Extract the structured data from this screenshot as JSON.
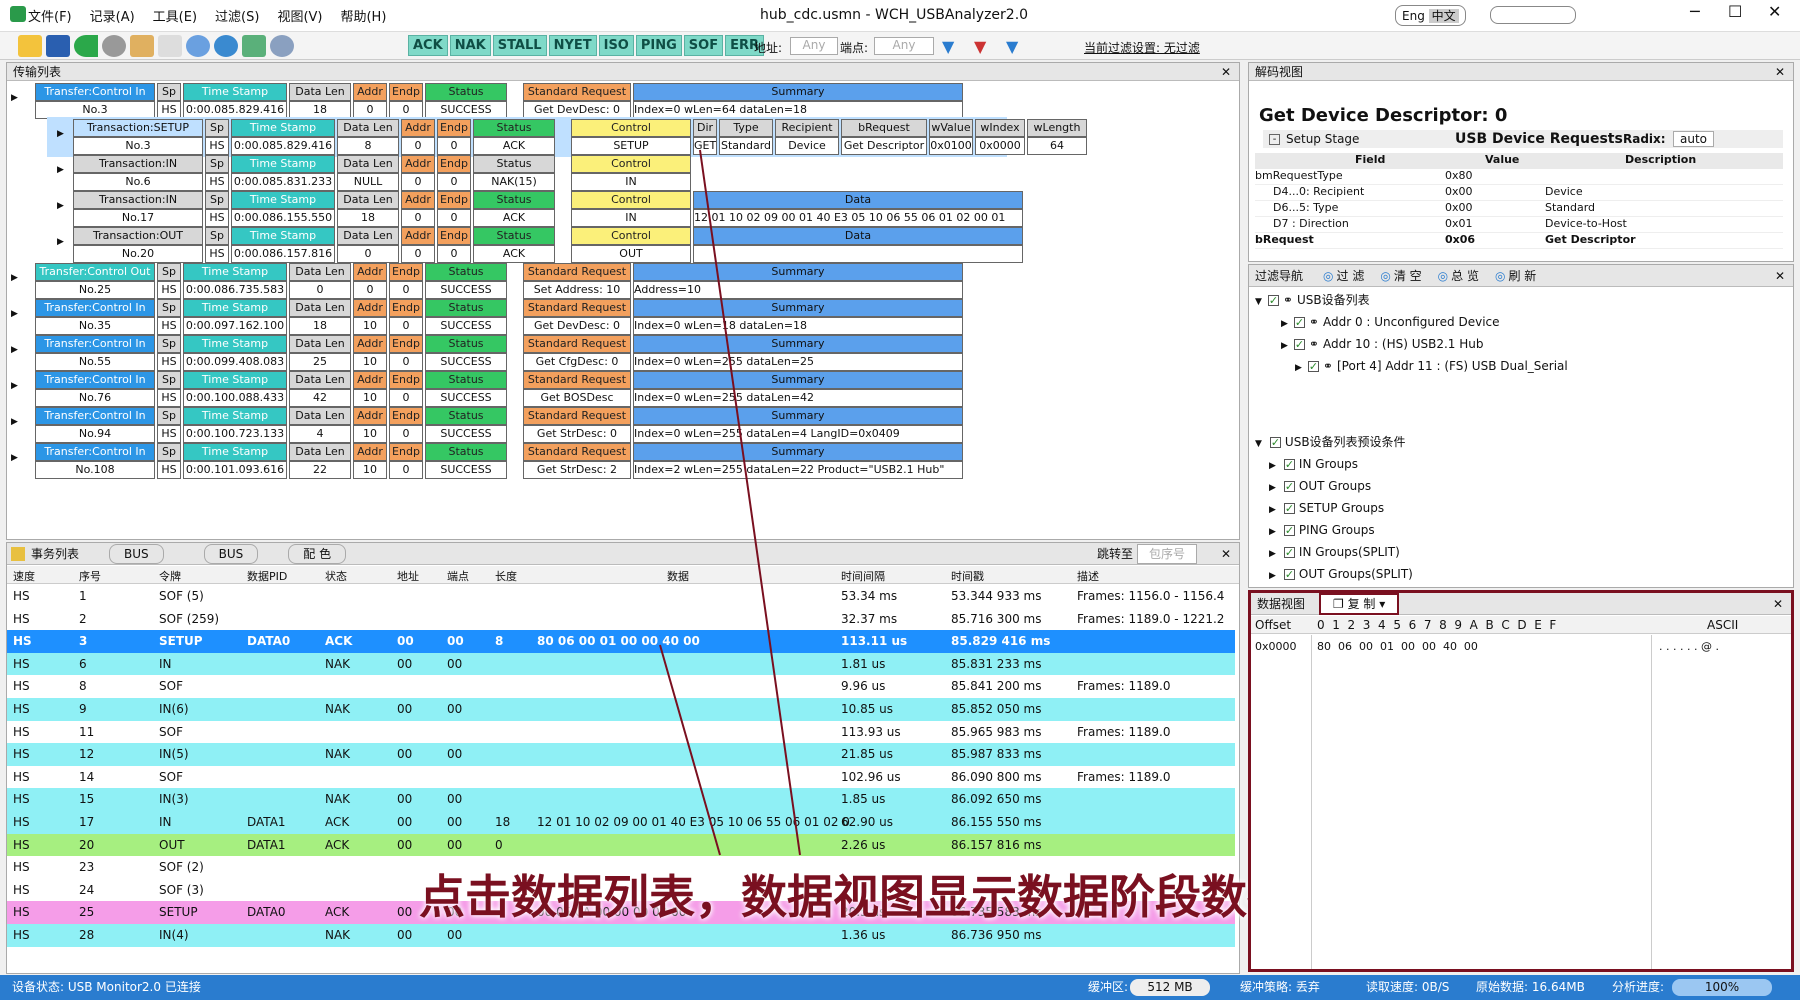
{
  "app": {
    "window_title": "hub_cdc.usmn - WCH_USBAnalyzer2.0",
    "lang": [
      "Eng",
      "中文"
    ],
    "menu": [
      "文件(F)",
      "记录(A)",
      "工具(E)",
      "过滤(S)",
      "视图(V)",
      "帮助(H)"
    ]
  },
  "toolbar": {
    "filters": [
      "ACK",
      "NAK",
      "STALL",
      "NYET",
      "ISO",
      "PING",
      "SOF",
      "ERR"
    ],
    "addr_label": "地址:",
    "addr_value": "Any",
    "endp_label": "端点:",
    "endp_value": "Any",
    "filter_setting": "当前过滤设置: 无过滤"
  },
  "transfer_pane": {
    "title": "传输列表",
    "header": {
      "tr": "Transfer:Control In",
      "sp": "Sp",
      "ts": "Time Stamp",
      "dl": "Data Len",
      "addr": "Addr",
      "endp": "Endp",
      "status": "Status",
      "std": "Standard Request",
      "sum": "Summary"
    },
    "rows": [
      {
        "type": "Transfer:Control In",
        "no": "No.3",
        "sp": "HS",
        "ts": "0:00.085.829.416",
        "dl": "18",
        "addr": "0",
        "endp": "0",
        "status": "SUCCESS",
        "req": "Get DevDesc: 0",
        "summary": "Index=0  wLen=64  dataLen=18"
      },
      {
        "type": "Transfer:Control Out",
        "no": "No.25",
        "sp": "HS",
        "ts": "0:00.086.735.583",
        "dl": "0",
        "addr": "0",
        "endp": "0",
        "status": "SUCCESS",
        "req": "Set Address: 10",
        "summary": "Address=10"
      },
      {
        "type": "Transfer:Control In",
        "no": "No.35",
        "sp": "HS",
        "ts": "0:00.097.162.100",
        "dl": "18",
        "addr": "10",
        "endp": "0",
        "status": "SUCCESS",
        "req": "Get DevDesc: 0",
        "summary": "Index=0  wLen=18  dataLen=18"
      },
      {
        "type": "Transfer:Control In",
        "no": "No.55",
        "sp": "HS",
        "ts": "0:00.099.408.083",
        "dl": "25",
        "addr": "10",
        "endp": "0",
        "status": "SUCCESS",
        "req": "Get CfgDesc: 0",
        "summary": "Index=0  wLen=255  dataLen=25"
      },
      {
        "type": "Transfer:Control In",
        "no": "No.76",
        "sp": "HS",
        "ts": "0:00.100.088.433",
        "dl": "42",
        "addr": "10",
        "endp": "0",
        "status": "SUCCESS",
        "req": "Get BOSDesc",
        "summary": "Index=0  wLen=255  dataLen=42"
      },
      {
        "type": "Transfer:Control In",
        "no": "No.94",
        "sp": "HS",
        "ts": "0:00.100.723.133",
        "dl": "4",
        "addr": "10",
        "endp": "0",
        "status": "SUCCESS",
        "req": "Get StrDesc: 0",
        "summary": "Index=0  wLen=255  dataLen=4  LangID=0x0409"
      },
      {
        "type": "Transfer:Control In",
        "no": "No.108",
        "sp": "HS",
        "ts": "0:00.101.093.616",
        "dl": "22",
        "addr": "10",
        "endp": "0",
        "status": "SUCCESS",
        "req": "Get StrDesc: 2",
        "summary": "Index=2  wLen=255  dataLen=22  Product=\"USB2.1 Hub\""
      }
    ],
    "transactions": [
      {
        "type": "Transaction:SETUP",
        "no": "No.3",
        "sp": "HS",
        "ts": "0:00.085.829.416",
        "dl": "8",
        "addr": "0",
        "endp": "0",
        "status": "ACK",
        "ctrl": "SETUP",
        "dir": "GET",
        "typ": "Standard",
        "rec": "Device",
        "breq": "Get Descriptor",
        "wval": "0x0100",
        "widx": "0x0000",
        "wlen": "64"
      },
      {
        "type": "Transaction:IN",
        "no": "No.6",
        "sp": "HS",
        "ts": "0:00.085.831.233",
        "dl": "NULL",
        "addr": "0",
        "endp": "0",
        "status": "NAK(15)",
        "ctrl": "IN"
      },
      {
        "type": "Transaction:IN",
        "no": "No.17",
        "sp": "HS",
        "ts": "0:00.086.155.550",
        "dl": "18",
        "addr": "0",
        "endp": "0",
        "status": "ACK",
        "ctrl": "IN",
        "data": "12 01 10 02 09 00 01 40 E3 05 10 06 55 06 01 02 00 01"
      },
      {
        "type": "Transaction:OUT",
        "no": "No.20",
        "sp": "HS",
        "ts": "0:00.086.157.816",
        "dl": "0",
        "addr": "0",
        "endp": "0",
        "status": "ACK",
        "ctrl": "OUT",
        "data": ""
      }
    ],
    "setup_hdr": {
      "ctrl": "Control",
      "dir": "Dir",
      "typ": "Type",
      "rec": "Recipient",
      "breq": "bRequest",
      "wval": "wValue",
      "widx": "wIndex",
      "wlen": "wLength",
      "data": "Data"
    }
  },
  "list_pane": {
    "title": "事务列表",
    "tabs": [
      "BUS",
      "BUS",
      "配 色"
    ],
    "jump": "跳转至",
    "jump_ph": "包序号",
    "columns": [
      "速度",
      "序号",
      "令牌",
      "数据PID",
      "状态",
      "地址",
      "端点",
      "长度",
      "数据",
      "时间间隔",
      "时间戳",
      "描述"
    ],
    "rows": [
      {
        "sp": "HS",
        "no": "1",
        "tok": "SOF (5)",
        "pid": "",
        "st": "",
        "ad": "",
        "ep": "",
        "len": "",
        "data": "",
        "ti": "53.34 ms",
        "ts": "53.344 933 ms",
        "desc": "Frames: 1156.0 - 1156.4",
        "c": "#ffffff"
      },
      {
        "sp": "HS",
        "no": "2",
        "tok": "SOF (259)",
        "pid": "",
        "st": "",
        "ad": "",
        "ep": "",
        "len": "",
        "data": "",
        "ti": "32.37 ms",
        "ts": "85.716 300 ms",
        "desc": "Frames: 1189.0 - 1221.2",
        "c": "#ffffff"
      },
      {
        "sp": "HS",
        "no": "3",
        "tok": "SETUP",
        "pid": "DATA0",
        "st": "ACK",
        "ad": "00",
        "ep": "00",
        "len": "8",
        "data": "80 06 00 01 00 00 40 00",
        "ti": "113.11 us",
        "ts": "85.829 416 ms",
        "desc": "",
        "c": "#1e90ff"
      },
      {
        "sp": "HS",
        "no": "6",
        "tok": "IN",
        "pid": "",
        "st": "NAK",
        "ad": "00",
        "ep": "00",
        "len": "",
        "data": "",
        "ti": "1.81 us",
        "ts": "85.831 233 ms",
        "desc": "",
        "c": "#8ff0f5"
      },
      {
        "sp": "HS",
        "no": "8",
        "tok": "SOF",
        "pid": "",
        "st": "",
        "ad": "",
        "ep": "",
        "len": "",
        "data": "",
        "ti": "9.96 us",
        "ts": "85.841 200 ms",
        "desc": "Frames: 1189.0",
        "c": "#ffffff"
      },
      {
        "sp": "HS",
        "no": "9",
        "tok": "IN(6)",
        "pid": "",
        "st": "NAK",
        "ad": "00",
        "ep": "00",
        "len": "",
        "data": "",
        "ti": "10.85 us",
        "ts": "85.852 050 ms",
        "desc": "",
        "c": "#8ff0f5"
      },
      {
        "sp": "HS",
        "no": "11",
        "tok": "SOF",
        "pid": "",
        "st": "",
        "ad": "",
        "ep": "",
        "len": "",
        "data": "",
        "ti": "113.93 us",
        "ts": "85.965 983 ms",
        "desc": "Frames: 1189.0",
        "c": "#ffffff"
      },
      {
        "sp": "HS",
        "no": "12",
        "tok": "IN(5)",
        "pid": "",
        "st": "NAK",
        "ad": "00",
        "ep": "00",
        "len": "",
        "data": "",
        "ti": "21.85 us",
        "ts": "85.987 833 ms",
        "desc": "",
        "c": "#8ff0f5"
      },
      {
        "sp": "HS",
        "no": "14",
        "tok": "SOF",
        "pid": "",
        "st": "",
        "ad": "",
        "ep": "",
        "len": "",
        "data": "",
        "ti": "102.96 us",
        "ts": "86.090 800 ms",
        "desc": "Frames: 1189.0",
        "c": "#ffffff"
      },
      {
        "sp": "HS",
        "no": "15",
        "tok": "IN(3)",
        "pid": "",
        "st": "NAK",
        "ad": "00",
        "ep": "00",
        "len": "",
        "data": "",
        "ti": "1.85 us",
        "ts": "86.092 650 ms",
        "desc": "",
        "c": "#8ff0f5"
      },
      {
        "sp": "HS",
        "no": "17",
        "tok": "IN",
        "pid": "DATA1",
        "st": "ACK",
        "ad": "00",
        "ep": "00",
        "len": "18",
        "data": "12 01 10 02 09 00 01 40 E3 05 10 06 55 06 01 02 0",
        "ti": "62.90 us",
        "ts": "86.155 550 ms",
        "desc": "",
        "c": "#8ff0f5"
      },
      {
        "sp": "HS",
        "no": "20",
        "tok": "OUT",
        "pid": "DATA1",
        "st": "ACK",
        "ad": "00",
        "ep": "00",
        "len": "0",
        "data": "",
        "ti": "2.26 us",
        "ts": "86.157 816 ms",
        "desc": "",
        "c": "#a6ef80"
      },
      {
        "sp": "HS",
        "no": "23",
        "tok": "SOF (2)",
        "pid": "",
        "st": "",
        "ad": "",
        "ep": "",
        "len": "",
        "data": "",
        "ti": "",
        "ts": "",
        "desc": "",
        "c": "#ffffff"
      },
      {
        "sp": "HS",
        "no": "24",
        "tok": "SOF (3)",
        "pid": "",
        "st": "",
        "ad": "",
        "ep": "",
        "len": "",
        "data": "",
        "ti": "",
        "ts": "",
        "desc": "",
        "c": "#ffffff"
      },
      {
        "sp": "HS",
        "no": "25",
        "tok": "SETUP",
        "pid": "DATA0",
        "st": "ACK",
        "ad": "00",
        "ep": "00",
        "len": "",
        "data": "00 05 0A 00 00 00 00 00",
        "ti": "20.5 us",
        "ts": "86.735 583 ms",
        "desc": "",
        "c": "#f59de8"
      },
      {
        "sp": "HS",
        "no": "28",
        "tok": "IN(4)",
        "pid": "",
        "st": "NAK",
        "ad": "00",
        "ep": "00",
        "len": "",
        "data": "",
        "ti": "1.36 us",
        "ts": "86.736 950 ms",
        "desc": "",
        "c": "#8ff0f5"
      }
    ],
    "caption": "点击数据列表，数据视图显示数据阶段数据"
  },
  "decode_pane": {
    "title": "解码视图",
    "heading": "Get Device Descriptor: 0",
    "stage": "Setup Stage",
    "proto": "USB Device Requests",
    "radix_label": "Radix:",
    "radix": "auto",
    "cols": [
      "Field",
      "Value",
      "Description"
    ],
    "rows": [
      [
        "bmRequestType",
        "0x80",
        ""
      ],
      [
        "D4...0: Recipient",
        "0x00",
        "Device"
      ],
      [
        "D6...5: Type",
        "0x00",
        "Standard"
      ],
      [
        "D7     : Direction",
        "0x01",
        "Device-to-Host"
      ],
      [
        "bRequest",
        "0x06",
        "Get Descriptor"
      ]
    ]
  },
  "nav_pane": {
    "title": "过滤导航",
    "buttons": [
      "过 滤",
      "清 空",
      "总 览",
      "刷 新"
    ],
    "tree1": [
      "USB设备列表",
      "Addr 0 : Unconfigured Device",
      "Addr 10 : (HS) USB2.1 Hub",
      "[Port 4]  Addr 11 : (FS) USB Dual_Serial"
    ],
    "tree2": [
      "USB设备列表预设条件",
      "IN Groups",
      "OUT Groups",
      "SETUP Groups",
      "PING Groups",
      "IN Groups(SPLIT)",
      "OUT Groups(SPLIT)"
    ]
  },
  "data_view": {
    "title": "数据视图",
    "copy": "复 制",
    "offset_label": "Offset",
    "hex_cols": "0  1  2  3  4  5  6  7  8  9  A  B  C  D  E  F",
    "ascii_label": "ASCII",
    "offset": "0x0000",
    "bytes": "80  06  00  01  00  00  40  00",
    "ascii": ". . . . . . @ ."
  },
  "status": {
    "device": "设备状态: USB Monitor2.0 已连接",
    "buf_label": "缓冲区:",
    "buf": "512 MB",
    "policy": "缓冲策略: 丢弃",
    "read": "读取速度: 0B/S",
    "raw": "原始数据: 16.64MB",
    "prog_label": "分析进度:",
    "prog": "100%",
    "prog_value": 1.0
  }
}
